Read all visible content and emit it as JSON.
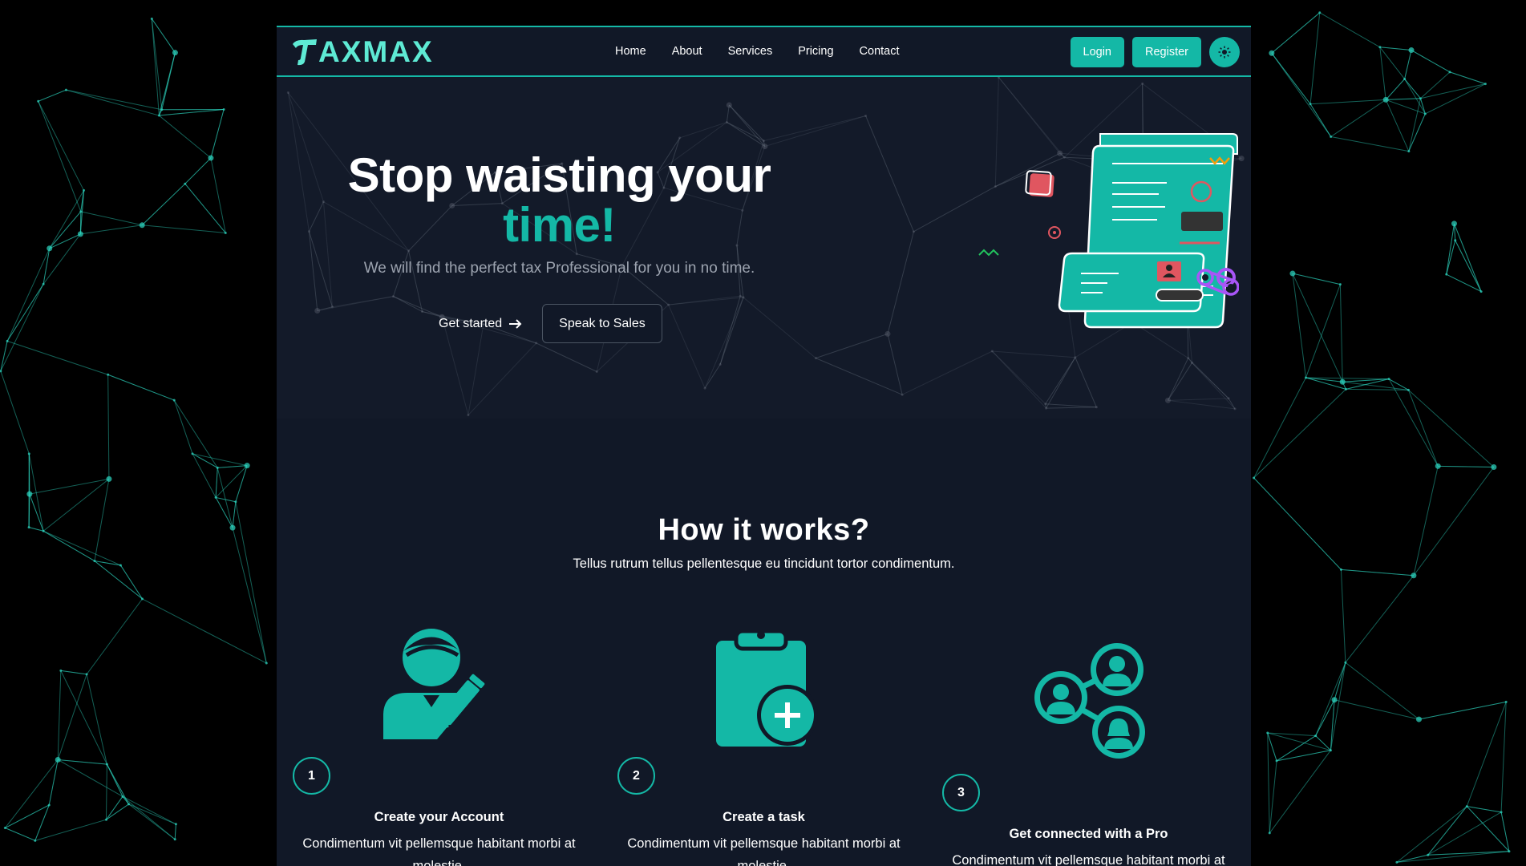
{
  "brand": {
    "logo_text": "AXMAX",
    "accent": "#14b8a6",
    "background": "#111827"
  },
  "nav": {
    "links": [
      "Home",
      "About",
      "Services",
      "Pricing",
      "Contact"
    ],
    "login_label": "Login",
    "register_label": "Register",
    "theme_icon": "sun-icon"
  },
  "hero": {
    "title_line1": "Stop waisting your",
    "title_line2": "time!",
    "subtitle": "We will find the perfect tax Professional for you in no time.",
    "cta_primary": "Get started",
    "cta_secondary": "Speak to Sales"
  },
  "how": {
    "title": "How it works?",
    "subtitle": "Tellus rutrum tellus pellentesque eu tincidunt tortor condimentum.",
    "steps": [
      {
        "number": "1",
        "title": "Create your Account",
        "text": "Condimentum vit pellemsque habitant morbi at molestie.",
        "icon": "user-edit-icon"
      },
      {
        "number": "2",
        "title": "Create a task",
        "text": "Condimentum vit pellemsque habitant morbi at molestie.",
        "icon": "clipboard-plus-icon"
      },
      {
        "number": "3",
        "title": "Get connected with a Pro",
        "text": "Condimentum vit pellemsque habitant morbi at molestie.",
        "icon": "people-network-icon"
      }
    ]
  }
}
